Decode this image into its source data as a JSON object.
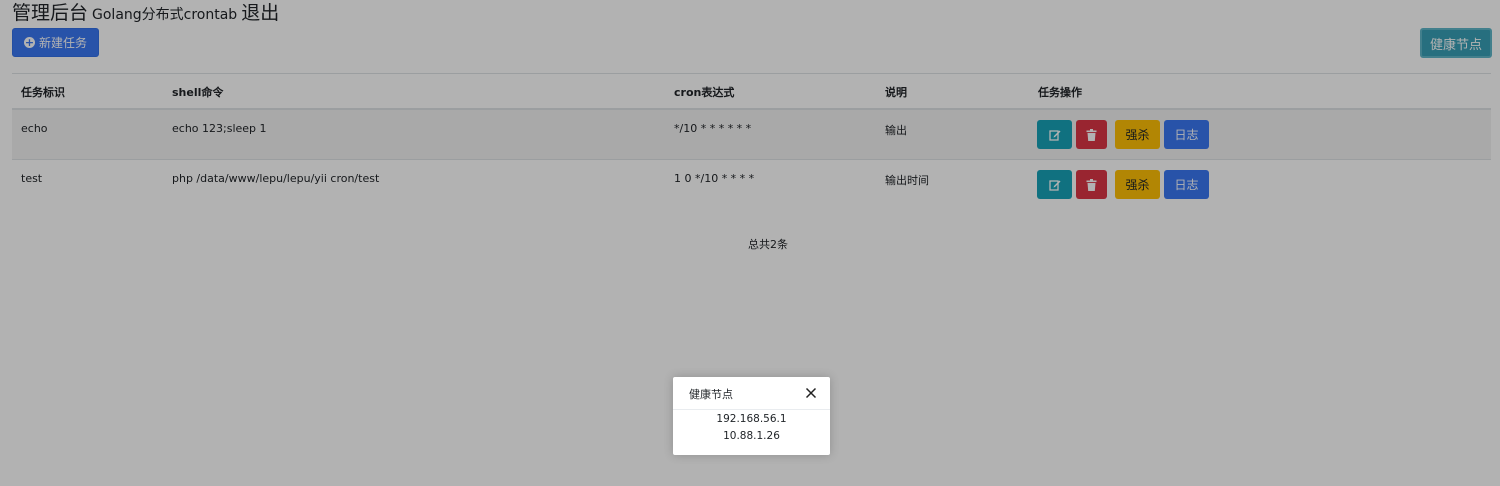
{
  "header": {
    "title": "管理后台",
    "subtitle": "Golang分布式crontab",
    "logout": "退出"
  },
  "toolbar": {
    "new_task_label": "新建任务",
    "health_nodes_label": "健康节点"
  },
  "table": {
    "columns": [
      "任务标识",
      "shell命令",
      "cron表达式",
      "说明",
      "任务操作"
    ],
    "rows": [
      {
        "id": "echo",
        "command": "echo 123;sleep 1",
        "cron": "*/10 * * * * * *",
        "desc": "输出",
        "kill_label": "强杀",
        "log_label": "日志"
      },
      {
        "id": "test",
        "command": "php /data/www/lepu/lepu/yii cron/test",
        "cron": "1 0 */10 * * * *",
        "desc": "输出时间",
        "kill_label": "强杀",
        "log_label": "日志"
      }
    ],
    "total": "总共2条"
  },
  "modal": {
    "title": "健康节点",
    "nodes": [
      "192.168.56.1",
      "10.88.1.26"
    ]
  },
  "colors": {
    "primary": "#3a78f2",
    "info": "#17a2b8",
    "danger": "#dc3545",
    "warning": "#ffc107"
  },
  "icons": {
    "new_task": "plus-circle-icon",
    "edit": "edit-icon",
    "delete": "trash-icon",
    "close": "close-icon"
  }
}
